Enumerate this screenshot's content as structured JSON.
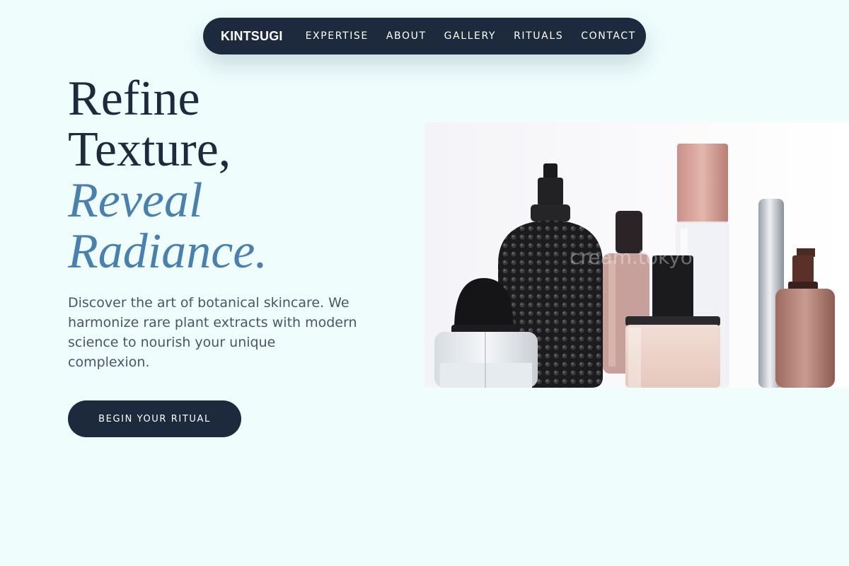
{
  "nav": {
    "brand": "KINTSUGI",
    "links": [
      "EXPERTISE",
      "ABOUT",
      "GALLERY",
      "RITUALS",
      "CONTACT"
    ]
  },
  "hero": {
    "title_line1": "Refine",
    "title_line2": "Texture,",
    "title_accent_line1": "Reveal",
    "title_accent_line2": "Radiance.",
    "description": "Discover the art of botanical skincare. We harmonize rare plant extracts with modern science to nourish your unique complexion.",
    "cta_label": "BEGIN YOUR RITUAL",
    "image_watermark": "cream.tokyo"
  },
  "colors": {
    "background": "#effdfd",
    "navy": "#1d2a3d",
    "accent_blue": "#4a80ad",
    "body_text": "#4a5566"
  }
}
